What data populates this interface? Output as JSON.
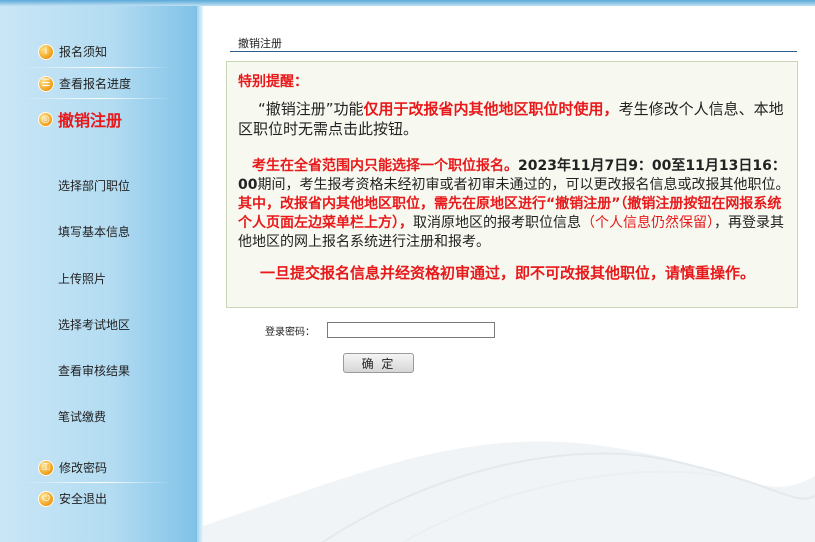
{
  "sidebar": {
    "top_links": [
      {
        "label": "报名须知",
        "icon": "info-icon"
      },
      {
        "label": "查看报名进度",
        "icon": "progress-icon"
      },
      {
        "label": "撤销注册",
        "icon": "cancel-icon",
        "active": true
      }
    ],
    "items": [
      {
        "label": "选择部门职位"
      },
      {
        "label": "填写基本信息"
      },
      {
        "label": "上传照片"
      },
      {
        "label": "选择考试地区"
      },
      {
        "label": "查看审核结果"
      },
      {
        "label": "笔试缴费"
      }
    ],
    "bottom_links": [
      {
        "label": "修改密码",
        "icon": "key-icon"
      },
      {
        "label": "安全退出",
        "icon": "exit-icon"
      }
    ]
  },
  "main": {
    "section_title": "撤销注册",
    "notice": {
      "heading": "特别提醒：",
      "p1_a": "“撤销注册”功能",
      "p1_b": "仅用于改报省内其他地区职位时使用，",
      "p1_c": "考生修改个人信息、本地区职位时无需点击此按钮。",
      "p2_a": "考生在全省范围内只能选择一个职位报名。",
      "p2_b": "2023年11月7日9：00至11月13日16：00",
      "p2_c": "期间，考生报考资格未经初审或者初审未通过的，可以更改报名信息或改报其他职位。",
      "p2_d": "其中，改报省内其他地区职位，需先在原地区进行“撤销注册”（撤销注册按钮在网报系统个人页面左边菜单栏上方），",
      "p2_e": "取消原地区的报考职位信息",
      "p2_f": "（个人信息仍然保留）",
      "p2_g": "，再登录其他地区的网上报名系统进行注册和报考。",
      "p3": "一旦提交报名信息并经资格初审通过，即不可改报其他职位，请慎重操作。"
    },
    "password_label": "登录密码：",
    "password_value": "",
    "confirm_label": "确 定"
  }
}
